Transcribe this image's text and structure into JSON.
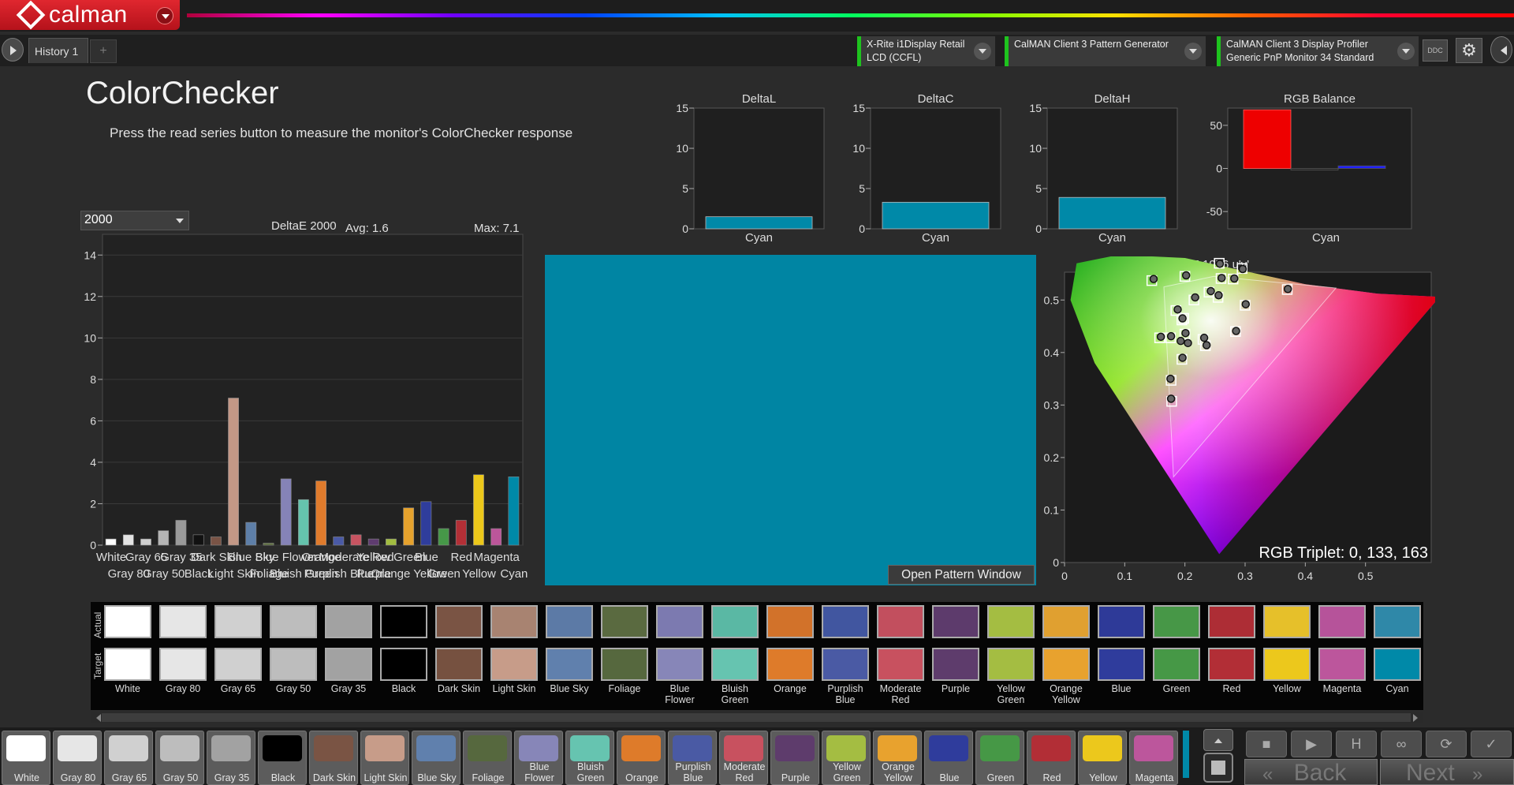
{
  "app": {
    "brand": "calman",
    "history_tab": "History 1",
    "add_tab": "+"
  },
  "devices": [
    {
      "line1": "X-Rite i1Display Retail",
      "line2": "LCD (CCFL)"
    },
    {
      "line1": "CalMAN Client 3 Pattern Generator",
      "line2": ""
    },
    {
      "line1": "CalMAN Client 3 Display Profiler",
      "line2": "Generic PnP Monitor 34 Standard"
    }
  ],
  "toolbar": {
    "ddc_label": "DDC"
  },
  "page": {
    "title": "ColorChecker",
    "subtitle": "Press the read series button to measure the monitor's ColorChecker response"
  },
  "delta_select": {
    "value": "2000"
  },
  "colors": {
    "bar_cyan": "#0089a8",
    "pattern": "#0085a3",
    "rgb_red": "#ee0000",
    "rgb_blue": "#2020ff"
  },
  "chart_data": [
    {
      "type": "bar",
      "title": "DeltaE 2000",
      "avg_label": "Avg: 1.6",
      "max_label": "Max: 7.1",
      "ylim": [
        0,
        15
      ],
      "yticks": [
        0,
        2,
        4,
        6,
        8,
        10,
        12,
        14
      ],
      "categories": [
        "White",
        "Gray 80",
        "Gray 65",
        "Gray 50",
        "Gray 35",
        "Black",
        "Dark Skin",
        "Light Skin",
        "Blue Sky",
        "Foliage",
        "Blue Flower",
        "Bluish Green",
        "Orange",
        "Purplish Blue",
        "Moderate Red",
        "Purple",
        "Yellow Green",
        "Orange Yellow",
        "Blue",
        "Green",
        "Red",
        "Yellow",
        "Magenta",
        "Cyan"
      ],
      "values": [
        0.3,
        0.5,
        0.3,
        0.7,
        1.2,
        0.5,
        0.4,
        7.1,
        1.1,
        0.1,
        3.2,
        2.2,
        3.1,
        0.4,
        0.5,
        0.3,
        0.3,
        1.8,
        2.1,
        0.8,
        1.2,
        3.4,
        0.8,
        3.3
      ],
      "colors": [
        "#ffffff",
        "#e3e3e3",
        "#cfcfcf",
        "#b5b5b5",
        "#9a9a9a",
        "#111111",
        "#7a5446",
        "#c39886",
        "#5e7fa8",
        "#5b6c3c",
        "#8583b7",
        "#65c3ad",
        "#e07b2c",
        "#4a5aa6",
        "#c75461",
        "#5f3c70",
        "#a2bd40",
        "#e6a22d",
        "#2f3d9c",
        "#469848",
        "#b32f36",
        "#ecc81a",
        "#bc569a",
        "#0089a8"
      ],
      "label_row1": [
        "White",
        "Gray 65",
        "Gray 35",
        "Dark Skin",
        "Blue Sky",
        "Blue Flower",
        "Orange",
        "Moderate Red",
        "Yellow Green",
        "Blue",
        "Red",
        "Magenta"
      ],
      "label_row2": [
        "Gray 80",
        "Gray 50",
        "Black",
        "Light Skin",
        "Foliage",
        "Bluish Green",
        "Purplish Blue",
        "Purple",
        "Orange Yellow",
        "Green",
        "Yellow",
        "Cyan"
      ]
    },
    {
      "type": "bar",
      "title": "DeltaL",
      "categories": [
        "Cyan"
      ],
      "values": [
        1.5
      ],
      "ylim": [
        0,
        15
      ],
      "yticks": [
        0,
        5,
        10,
        15
      ]
    },
    {
      "type": "bar",
      "title": "DeltaC",
      "categories": [
        "Cyan"
      ],
      "values": [
        3.3
      ],
      "ylim": [
        0,
        15
      ],
      "yticks": [
        0,
        5,
        10,
        15
      ]
    },
    {
      "type": "bar",
      "title": "DeltaH",
      "categories": [
        "Cyan"
      ],
      "values": [
        3.9
      ],
      "ylim": [
        0,
        15
      ],
      "yticks": [
        0,
        5,
        10,
        15
      ]
    },
    {
      "type": "bar",
      "title": "RGB Balance",
      "category_label": "Cyan",
      "series": [
        {
          "name": "R",
          "value": 68
        },
        {
          "name": "G",
          "value": 0
        },
        {
          "name": "B",
          "value": 3
        }
      ],
      "ylim": [
        -70,
        70
      ],
      "yticks": [
        -50,
        0,
        50
      ]
    },
    {
      "type": "scatter",
      "title": "CIE 1976 u'v'",
      "xlim": [
        0,
        0.6
      ],
      "ylim": [
        0,
        0.6
      ],
      "xticks": [
        0,
        0.1,
        0.2,
        0.3,
        0.4,
        0.5
      ],
      "yticks": [
        0,
        0.1,
        0.2,
        0.3,
        0.4,
        0.5
      ],
      "gamut": [
        [
          0.248,
          0.545
        ],
        [
          0.165,
          0.525
        ],
        [
          0.181,
          0.163
        ],
        [
          0.451,
          0.523
        ]
      ],
      "targets": [
        [
          0.176,
          0.428
        ],
        [
          0.195,
          0.462
        ],
        [
          0.2,
          0.435
        ],
        [
          0.215,
          0.5
        ],
        [
          0.145,
          0.537
        ],
        [
          0.2,
          0.545
        ],
        [
          0.185,
          0.48
        ],
        [
          0.23,
          0.425
        ],
        [
          0.255,
          0.505
        ],
        [
          0.24,
          0.515
        ],
        [
          0.257,
          0.57
        ],
        [
          0.26,
          0.541
        ],
        [
          0.28,
          0.54
        ],
        [
          0.295,
          0.56
        ],
        [
          0.3,
          0.49
        ],
        [
          0.37,
          0.52
        ],
        [
          0.284,
          0.44
        ],
        [
          0.195,
          0.387
        ],
        [
          0.177,
          0.347
        ],
        [
          0.178,
          0.307
        ],
        [
          0.234,
          0.413
        ],
        [
          0.158,
          0.428
        ],
        [
          0.198,
          0.465
        ],
        [
          0.198,
          0.465
        ]
      ],
      "actuals": [
        [
          0.177,
          0.431
        ],
        [
          0.196,
          0.465
        ],
        [
          0.201,
          0.437
        ],
        [
          0.217,
          0.505
        ],
        [
          0.148,
          0.54
        ],
        [
          0.202,
          0.547
        ],
        [
          0.188,
          0.482
        ],
        [
          0.232,
          0.428
        ],
        [
          0.256,
          0.509
        ],
        [
          0.243,
          0.517
        ],
        [
          0.258,
          0.569
        ],
        [
          0.261,
          0.542
        ],
        [
          0.282,
          0.541
        ],
        [
          0.296,
          0.559
        ],
        [
          0.301,
          0.492
        ],
        [
          0.371,
          0.521
        ],
        [
          0.285,
          0.441
        ],
        [
          0.196,
          0.39
        ],
        [
          0.176,
          0.35
        ],
        [
          0.177,
          0.312
        ],
        [
          0.236,
          0.414
        ],
        [
          0.16,
          0.43
        ],
        [
          0.193,
          0.422
        ],
        [
          0.205,
          0.418
        ]
      ],
      "rgb_triplet": "RGB Triplet: 0, 133, 163"
    }
  ],
  "pattern": {
    "button_label": "Open Pattern Window"
  },
  "swatches": {
    "actual_label": "Actual",
    "target_label": "Target",
    "items": [
      {
        "name": "White",
        "actual": "#ffffff",
        "target": "#ffffff"
      },
      {
        "name": "Gray 80",
        "actual": "#e6e6e6",
        "target": "#e6e6e6"
      },
      {
        "name": "Gray 65",
        "actual": "#d0d0d0",
        "target": "#d0d0d0"
      },
      {
        "name": "Gray 50",
        "actual": "#bdbdbd",
        "target": "#bdbdbd"
      },
      {
        "name": "Gray 35",
        "actual": "#a2a2a2",
        "target": "#a2a2a2"
      },
      {
        "name": "Black",
        "actual": "#000000",
        "target": "#000000"
      },
      {
        "name": "Dark Skin",
        "actual": "#7a5444",
        "target": "#765140"
      },
      {
        "name": "Light Skin",
        "actual": "#a88371",
        "target": "#c79c89"
      },
      {
        "name": "Blue Sky",
        "actual": "#5c7aa6",
        "target": "#6080ad"
      },
      {
        "name": "Foliage",
        "actual": "#5a6a40",
        "target": "#56683e"
      },
      {
        "name": "Blue\nFlower",
        "actual": "#7c7ab0",
        "target": "#8786b8"
      },
      {
        "name": "Bluish\nGreen",
        "actual": "#5ab8a4",
        "target": "#66c4b0"
      },
      {
        "name": "Orange",
        "actual": "#d2722a",
        "target": "#de7b2a"
      },
      {
        "name": "Purplish\nBlue",
        "actual": "#4156a0",
        "target": "#4a5aa4"
      },
      {
        "name": "Moderate\nRed",
        "actual": "#c24f5e",
        "target": "#c8515f"
      },
      {
        "name": "Purple",
        "actual": "#5d3b6c",
        "target": "#5e3c6c"
      },
      {
        "name": "Yellow\nGreen",
        "actual": "#a4bd42",
        "target": "#a4bd42"
      },
      {
        "name": "Orange\nYellow",
        "actual": "#e0a030",
        "target": "#e8a22e"
      },
      {
        "name": "Blue",
        "actual": "#2e3a98",
        "target": "#2f3c9c"
      },
      {
        "name": "Green",
        "actual": "#479747",
        "target": "#469846"
      },
      {
        "name": "Red",
        "actual": "#ad2d35",
        "target": "#b22e36"
      },
      {
        "name": "Yellow",
        "actual": "#e6c02a",
        "target": "#ecc81c"
      },
      {
        "name": "Magenta",
        "actual": "#b6539a",
        "target": "#bc569c"
      },
      {
        "name": "Cyan",
        "actual": "#2f88a8",
        "target": "#0089a8"
      }
    ]
  },
  "bottom_swatches": [
    {
      "label": "White",
      "color": "#ffffff"
    },
    {
      "label": "Gray 80",
      "color": "#e6e6e6"
    },
    {
      "label": "Gray 65",
      "color": "#d0d0d0"
    },
    {
      "label": "Gray 50",
      "color": "#bdbdbd"
    },
    {
      "label": "Gray 35",
      "color": "#a2a2a2"
    },
    {
      "label": "Black",
      "color": "#000000"
    },
    {
      "label": "Dark Skin",
      "color": "#7a5444"
    },
    {
      "label": "Light Skin",
      "color": "#c79c89"
    },
    {
      "label": "Blue Sky",
      "color": "#6080ad"
    },
    {
      "label": "Foliage",
      "color": "#56683e"
    },
    {
      "label": "Blue\nFlower",
      "color": "#8786b8"
    },
    {
      "label": "Bluish\nGreen",
      "color": "#66c4b0"
    },
    {
      "label": "Orange",
      "color": "#de7b2a"
    },
    {
      "label": "Purplish\nBlue",
      "color": "#4a5aa4"
    },
    {
      "label": "Moderate\nRed",
      "color": "#c8515f"
    },
    {
      "label": "Purple",
      "color": "#5e3c6c"
    },
    {
      "label": "Yellow\nGreen",
      "color": "#a4bd42"
    },
    {
      "label": "Orange\nYellow",
      "color": "#e8a22e"
    },
    {
      "label": "Blue",
      "color": "#2f3c9c"
    },
    {
      "label": "Green",
      "color": "#469846"
    },
    {
      "label": "Red",
      "color": "#b22e36"
    },
    {
      "label": "Yellow",
      "color": "#ecc81c"
    },
    {
      "label": "Magenta",
      "color": "#bc569c"
    }
  ],
  "navigation": {
    "back": "Back",
    "next": "Next",
    "back_icon": "double-chevron-left",
    "next_icon": "double-chevron-right"
  },
  "controls": [
    "stop-icon",
    "play-icon",
    "hold-icon",
    "infinity-icon",
    "refresh-icon",
    "check-icon"
  ]
}
